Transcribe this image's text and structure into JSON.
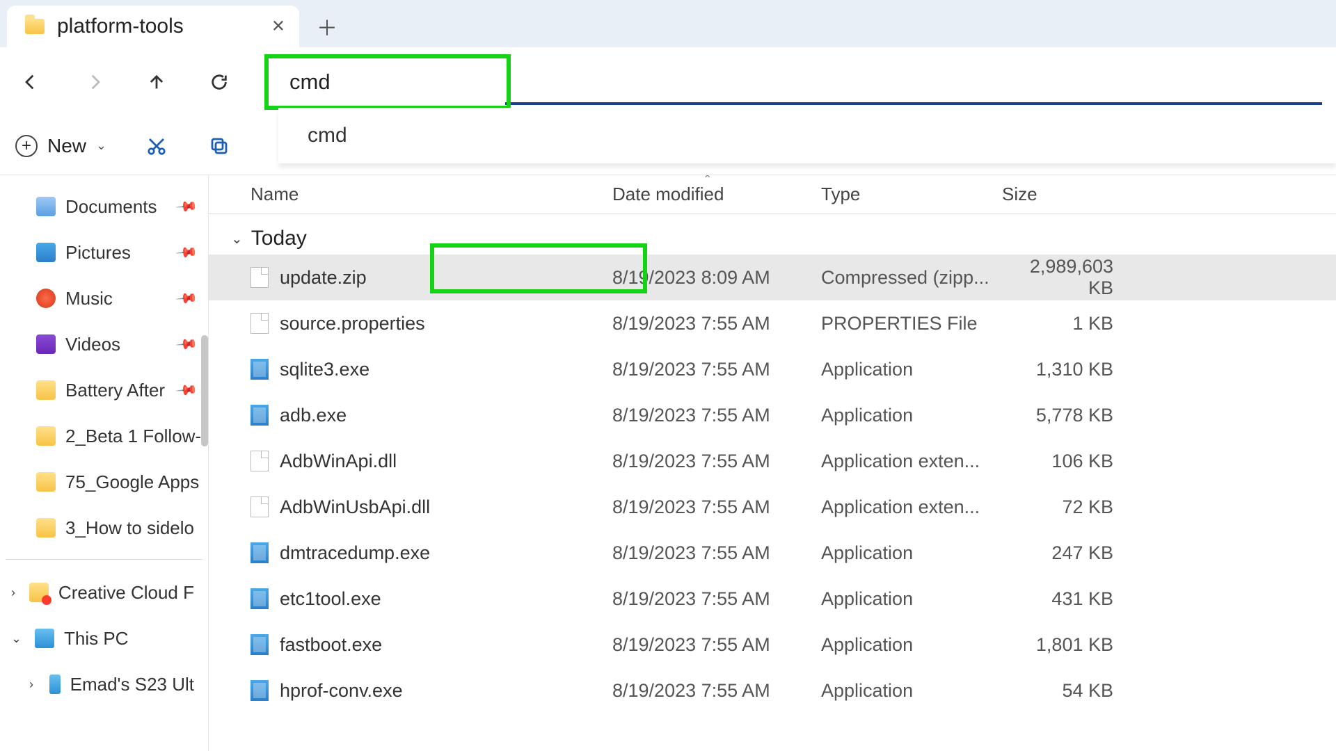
{
  "tab": {
    "title": "platform-tools"
  },
  "address": {
    "value": "cmd",
    "suggestion": "cmd"
  },
  "toolbar": {
    "new_label": "New"
  },
  "sidebar": {
    "pinned": [
      {
        "label": "Documents",
        "icon": "doc",
        "pinned": true
      },
      {
        "label": "Pictures",
        "icon": "pic",
        "pinned": true
      },
      {
        "label": "Music",
        "icon": "mus",
        "pinned": true
      },
      {
        "label": "Videos",
        "icon": "vid",
        "pinned": true
      },
      {
        "label": "Battery After",
        "icon": "fol",
        "pinned": true
      },
      {
        "label": "2_Beta 1 Follow-",
        "icon": "fol",
        "pinned": false
      },
      {
        "label": "75_Google Apps",
        "icon": "fol",
        "pinned": false
      },
      {
        "label": "3_How to sidelo",
        "icon": "fol",
        "pinned": false
      }
    ],
    "tree": [
      {
        "label": "Creative Cloud F",
        "icon": "cc",
        "expandable": true,
        "expanded": false
      },
      {
        "label": "This PC",
        "icon": "pc",
        "expandable": true,
        "expanded": true
      },
      {
        "label": "Emad's S23 Ult",
        "icon": "ph",
        "expandable": true,
        "expanded": false,
        "indent": 1
      }
    ]
  },
  "columns": {
    "name": "Name",
    "date": "Date modified",
    "type": "Type",
    "size": "Size"
  },
  "group_label": "Today",
  "files": [
    {
      "name": "update.zip",
      "date": "8/19/2023 8:09 AM",
      "type": "Compressed (zipp...",
      "size": "2,989,603 KB",
      "icon": "file",
      "selected": true,
      "highlight": true
    },
    {
      "name": "source.properties",
      "date": "8/19/2023 7:55 AM",
      "type": "PROPERTIES File",
      "size": "1 KB",
      "icon": "file"
    },
    {
      "name": "sqlite3.exe",
      "date": "8/19/2023 7:55 AM",
      "type": "Application",
      "size": "1,310 KB",
      "icon": "exe"
    },
    {
      "name": "adb.exe",
      "date": "8/19/2023 7:55 AM",
      "type": "Application",
      "size": "5,778 KB",
      "icon": "exe"
    },
    {
      "name": "AdbWinApi.dll",
      "date": "8/19/2023 7:55 AM",
      "type": "Application exten...",
      "size": "106 KB",
      "icon": "file"
    },
    {
      "name": "AdbWinUsbApi.dll",
      "date": "8/19/2023 7:55 AM",
      "type": "Application exten...",
      "size": "72 KB",
      "icon": "file"
    },
    {
      "name": "dmtracedump.exe",
      "date": "8/19/2023 7:55 AM",
      "type": "Application",
      "size": "247 KB",
      "icon": "exe"
    },
    {
      "name": "etc1tool.exe",
      "date": "8/19/2023 7:55 AM",
      "type": "Application",
      "size": "431 KB",
      "icon": "exe"
    },
    {
      "name": "fastboot.exe",
      "date": "8/19/2023 7:55 AM",
      "type": "Application",
      "size": "1,801 KB",
      "icon": "exe"
    },
    {
      "name": "hprof-conv.exe",
      "date": "8/19/2023 7:55 AM",
      "type": "Application",
      "size": "54 KB",
      "icon": "exe"
    }
  ]
}
